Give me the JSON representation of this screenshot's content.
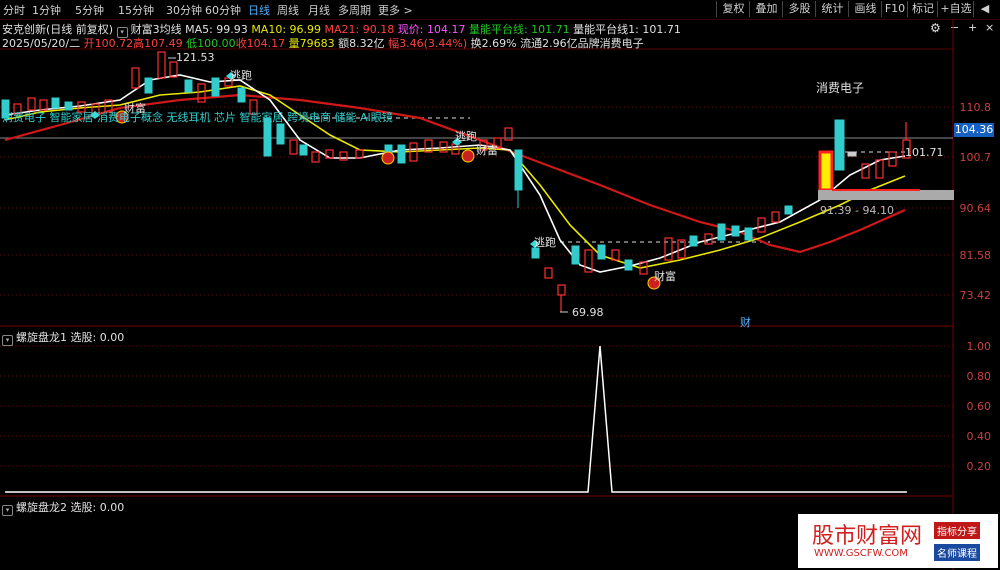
{
  "toolbar": {
    "periods": [
      "分时",
      "1分钟",
      "5分钟",
      "15分钟",
      "30分钟",
      "60分钟",
      "日线",
      "周线",
      "月线",
      "多周期",
      "更多 >"
    ],
    "active_period": "日线",
    "right_buttons": [
      "复权",
      "叠加",
      "多股",
      "统计",
      "画线",
      "F10",
      "标记",
      "+自选",
      "◀"
    ]
  },
  "header": {
    "stock": "安克创新(日线 前复权)",
    "indicator": "财富3均线",
    "ma5": "MA5: 99.93",
    "ma10": "MA10: 96.99",
    "ma21": "MA21: 90.18",
    "current": "现价: 104.17",
    "platform_line": "量能平台线: 101.71",
    "platform_line1": "量能平台线1: 101.71"
  },
  "quote": {
    "date": "2025/05/20/二",
    "open": "开100.72",
    "high": "高107.49",
    "low": "低100.00",
    "close": "收104.17",
    "volume": "量79683",
    "amount": "额8.32亿",
    "change": "幅3.46(3.44%)",
    "turnover": "换2.69%",
    "float": "流通2.96亿",
    "brand": "品牌消费电子"
  },
  "concepts": "消费电子 智能家居  消费电子概念  无线耳机  芯片  智能家居  跨境电商  储能  AI眼镜",
  "annotations": {
    "sector_label": "消费电子",
    "high_label": "121.53",
    "low_label": "69.98",
    "platform_value": "101.71",
    "range_label": "91.39 - 94.10",
    "escape1": "逃跑",
    "escape2": "逃跑",
    "escape3": "逃跑",
    "fortune1": "财富",
    "fortune2": "财富",
    "fortune3": "财富",
    "cai_marker": "财"
  },
  "price_axis": [
    "110.8",
    "100.7",
    "90.64",
    "81.58",
    "73.42"
  ],
  "current_price_box": "104.36",
  "panel1": {
    "title": "螺旋盘龙1",
    "value": "选股: 0.00",
    "axis": [
      "1.00",
      "0.80",
      "0.60",
      "0.40",
      "0.20"
    ]
  },
  "panel2": {
    "title": "螺旋盘龙2",
    "value": "选股: 0.00"
  },
  "watermark": {
    "title": "股市财富网",
    "url": "WWW.GSCFW.COM",
    "tag1": "指标分享",
    "tag2": "名师课程"
  },
  "colors": {
    "up": "#33cccc",
    "down": "#ff3030",
    "ma5": "#ffffff",
    "ma10": "#e8e800",
    "ma21": "#d01818",
    "accent": "#1560c0"
  }
}
